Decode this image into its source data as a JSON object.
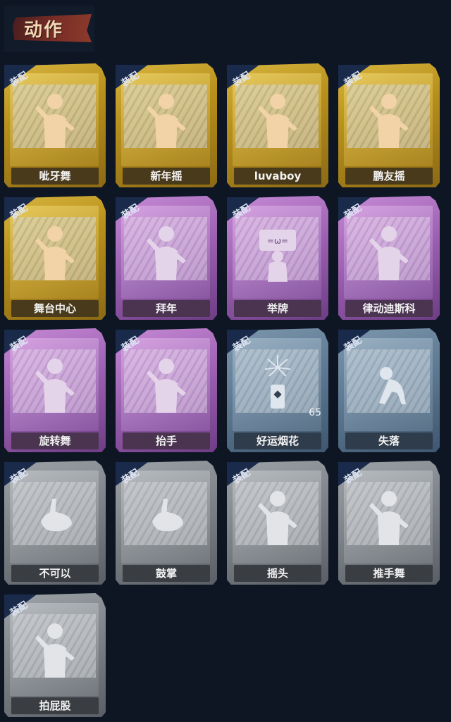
{
  "header": {
    "title": "动作"
  },
  "equip_label": "装配",
  "cards": [
    {
      "label": "呲牙舞",
      "tier": "gold",
      "icon": "dance-figure-icon"
    },
    {
      "label": "新年摇",
      "tier": "gold",
      "icon": "shake-figure-icon"
    },
    {
      "label": "luvaboy",
      "tier": "gold",
      "icon": "pose-figure-icon"
    },
    {
      "label": "鹏友摇",
      "tier": "gold",
      "icon": "shake-figure-icon"
    },
    {
      "label": "舞台中心",
      "tier": "gold",
      "icon": "stage-figure-icon"
    },
    {
      "label": "拜年",
      "tier": "purple",
      "icon": "greeting-figure-icon"
    },
    {
      "label": "举牌",
      "tier": "purple",
      "icon": "sign-figure-icon"
    },
    {
      "label": "律动迪斯科",
      "tier": "purple",
      "icon": "disco-figure-icon"
    },
    {
      "label": "旋转舞",
      "tier": "purple",
      "icon": "spin-figure-icon"
    },
    {
      "label": "抬手",
      "tier": "purple",
      "icon": "raise-hand-figure-icon"
    },
    {
      "label": "好运烟花",
      "tier": "blue",
      "icon": "firework-icon",
      "count": "65"
    },
    {
      "label": "失落",
      "tier": "blue",
      "icon": "crawl-figure-icon"
    },
    {
      "label": "不可以",
      "tier": "gray",
      "icon": "finger-wag-icon"
    },
    {
      "label": "鼓掌",
      "tier": "gray",
      "icon": "clap-icon"
    },
    {
      "label": "摇头",
      "tier": "gray",
      "icon": "head-shake-figure-icon"
    },
    {
      "label": "推手舞",
      "tier": "gray",
      "icon": "push-hand-figure-icon"
    },
    {
      "label": "拍屁股",
      "tier": "gray",
      "icon": "butt-slap-figure-icon"
    }
  ]
}
